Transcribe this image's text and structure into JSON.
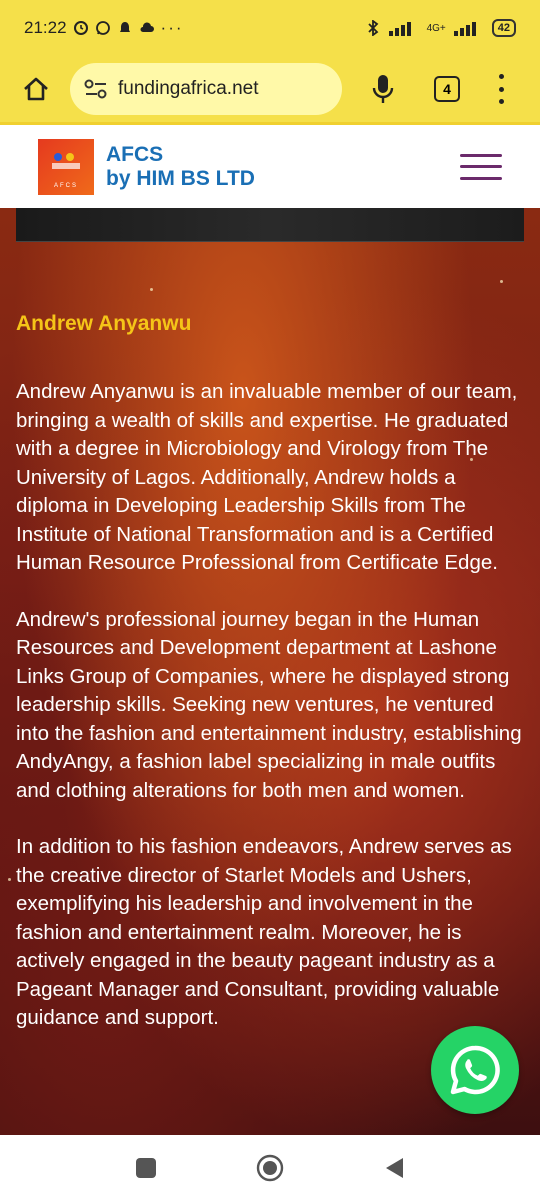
{
  "status": {
    "time": "21:22",
    "network": "4G+",
    "battery": "42"
  },
  "browser": {
    "url": "fundingafrica.net",
    "tab_count": "4"
  },
  "site": {
    "logo_tag": "AFCS",
    "brand_line1": "AFCS",
    "brand_line2": "by HIM BS LTD"
  },
  "profile": {
    "name": "Andrew Anyanwu",
    "paragraphs": [
      "Andrew Anyanwu is an invaluable member of our team, bringing a wealth of skills and expertise. He graduated with a degree in Microbiology and Virology from The University of Lagos. Additionally, Andrew holds a diploma in Developing Leadership Skills from The Institute of National Transformation and is a Certified Human Resource Professional from Certificate Edge.",
      "Andrew's professional journey began in the Human Resources and Development department at Lashone Links Group of Companies, where he displayed strong leadership skills. Seeking new ventures, he ventured into the fashion and entertainment industry, establishing AndyAngy, a fashion label specializing in male outfits and clothing alterations for both men and women.",
      "In addition to his fashion endeavors, Andrew serves as the creative director of Starlet Models and Ushers, exemplifying his leadership and involvement in the fashion and entertainment realm. Moreover, he is actively engaged in the beauty pageant industry as a Pageant Manager and Consultant, providing valuable guidance and support."
    ]
  },
  "colors": {
    "status_bar": "#f5e04a",
    "brand_blue": "#1a6fb5",
    "name_yellow": "#f5c518",
    "whatsapp": "#25d366"
  },
  "icons": {
    "home": "home-icon",
    "site_settings": "site-settings-icon",
    "mic": "mic-icon",
    "menu": "more-vert-icon",
    "hamburger": "hamburger-icon",
    "whatsapp": "whatsapp-icon",
    "nav_recents": "square-icon",
    "nav_home": "circle-icon",
    "nav_back": "back-triangle-icon"
  }
}
